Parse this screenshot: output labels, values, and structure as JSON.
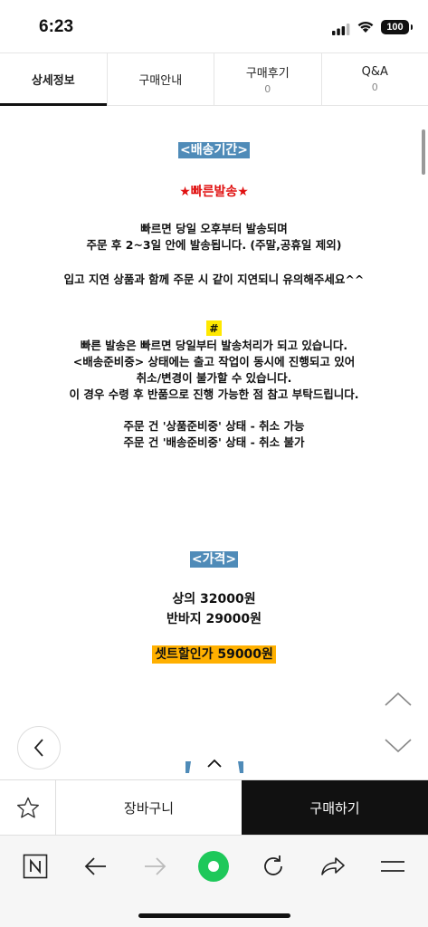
{
  "status_bar": {
    "time": "6:23",
    "battery": "100"
  },
  "tabs": [
    {
      "label": "상세정보",
      "count": ""
    },
    {
      "label": "구매안내",
      "count": ""
    },
    {
      "label": "구매후기",
      "count": "0"
    },
    {
      "label": "Q&A",
      "count": "0"
    }
  ],
  "content": {
    "shipping_heading": "<배송기간>",
    "fast_shipping": "★빠른발송★",
    "ship_line1": "빠르면 당일 오후부터 발송되며",
    "ship_line2": "주문 후 2~3일 안에 발송됩니다. (주말,공휴일 제외)",
    "ship_line3": "입고 지연 상품과 함께 주문 시 같이 지연되니 유의해주세요^^",
    "hash": "#",
    "note_line1": "빠른 발송은 빠르면 당일부터 발송처리가 되고 있습니다.",
    "note_line2": "<배송준비중> 상태에는 출고 작업이 동시에 진행되고 있어",
    "note_line3": "취소/변경이 불가할 수 있습니다.",
    "note_line4": "이 경우 수령 후 반품으로 진행 가능한 점 참고 부탁드립니다.",
    "cancel_line1": "주문 건 '상품준비중' 상태 - 취소 가능",
    "cancel_line2": "주문 건 '배송준비중' 상태 - 취소 불가",
    "price_heading": "<가격>",
    "price_top": "상의 32000원",
    "price_bottom": "반바지 29000원",
    "set_price": "셋트할인가 59000원"
  },
  "action_bar": {
    "cart_label": "장바구니",
    "buy_label": "구매하기"
  },
  "colors": {
    "heading_bg": "#4f8bb8",
    "highlight_yellow": "#ffe800",
    "highlight_orange": "#ffb000",
    "accent_red": "#e01010",
    "browser_green": "#1ec85a"
  }
}
